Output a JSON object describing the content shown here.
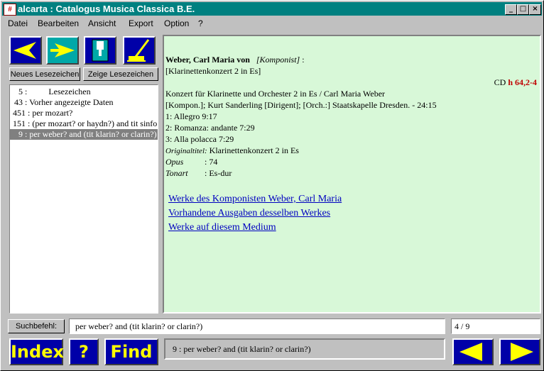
{
  "window": {
    "title": "alcarta : Catalogus Musica Classica B.E.",
    "app_icon": "alcarta-icon",
    "controls": {
      "minimize": "_",
      "maximize": "□",
      "close": "×"
    }
  },
  "menu": [
    {
      "label": "Datei"
    },
    {
      "label": "Bearbeiten"
    },
    {
      "label": "Ansicht"
    },
    {
      "label": "Export"
    },
    {
      "label": "Option"
    },
    {
      "label": "?"
    }
  ],
  "toolbar": {
    "icons": [
      "back-arrow-icon",
      "forward-arrow-icon",
      "document-icon",
      "broom-icon"
    ],
    "new_bookmark_label": "Neues Lesezeichen",
    "show_bookmark_label": "Zeige Lesezeichen"
  },
  "history": [
    {
      "num": "5",
      "text": "Lesezeichen"
    },
    {
      "num": "43",
      "text": "Vorher angezeigte Daten"
    },
    {
      "num": "451",
      "text": "per mozart?"
    },
    {
      "num": "151",
      "text": "(per mozart? or haydn?) and tit sinfo"
    },
    {
      "num": "9",
      "text": "per weber? and (tit klarin? or clarin?)"
    }
  ],
  "record": {
    "composer": "Weber, Carl Maria von",
    "role": "[Komponist]",
    "colon": ":",
    "uniform_title": "[Klarinettenkonzert 2 in Es]",
    "medium_prefix": "CD",
    "medium_id": "h 64,2-4",
    "title_line": "Konzert für Klarinette und Orchester 2 in Es / Carl Maria Weber",
    "contributors": "[Kompon.]; Kurt Sanderling [Dirigent]; [Orch.:] Staatskapelle Dresden. - 24:15",
    "tracks": [
      "1: Allegro 9:17",
      "2: Romanza: andante 7:29",
      "3: Alla polacca 7:29"
    ],
    "fields": [
      {
        "label": "Originaltitel:",
        "value": "Klarinettenkonzert 2 in Es"
      },
      {
        "label": "Opus",
        "value": ": 74"
      },
      {
        "label": "Tonart",
        "value": ": Es-dur"
      }
    ],
    "links": [
      "Werke des Komponisten Weber, Carl Maria",
      "Vorhandene Ausgaben desselben Werkes",
      "Werke auf diesem Medium"
    ]
  },
  "search": {
    "label": "Suchbefehl:",
    "value": "per weber? and (tit klarin? or clarin?)",
    "counter": "4 / 9"
  },
  "bottom": {
    "index_label": "Index",
    "help_label": "?",
    "find_label": "Find",
    "status": "9 : per weber? and (tit klarin? or clarin?)"
  },
  "colors": {
    "accent": "#0000a8",
    "title_bar": "#008080",
    "detail_bg": "#d8f8d8",
    "link": "#0000c0",
    "medium_id": "#c00000"
  }
}
